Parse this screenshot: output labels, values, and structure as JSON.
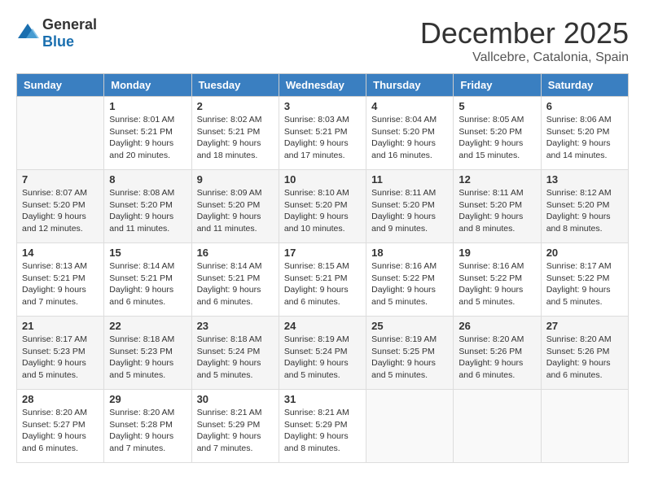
{
  "logo": {
    "general": "General",
    "blue": "Blue"
  },
  "title": {
    "month": "December 2025",
    "location": "Vallcebre, Catalonia, Spain"
  },
  "headers": [
    "Sunday",
    "Monday",
    "Tuesday",
    "Wednesday",
    "Thursday",
    "Friday",
    "Saturday"
  ],
  "weeks": [
    [
      {
        "day": "",
        "sunrise": "",
        "sunset": "",
        "daylight": ""
      },
      {
        "day": "1",
        "sunrise": "Sunrise: 8:01 AM",
        "sunset": "Sunset: 5:21 PM",
        "daylight": "Daylight: 9 hours and 20 minutes."
      },
      {
        "day": "2",
        "sunrise": "Sunrise: 8:02 AM",
        "sunset": "Sunset: 5:21 PM",
        "daylight": "Daylight: 9 hours and 18 minutes."
      },
      {
        "day": "3",
        "sunrise": "Sunrise: 8:03 AM",
        "sunset": "Sunset: 5:21 PM",
        "daylight": "Daylight: 9 hours and 17 minutes."
      },
      {
        "day": "4",
        "sunrise": "Sunrise: 8:04 AM",
        "sunset": "Sunset: 5:20 PM",
        "daylight": "Daylight: 9 hours and 16 minutes."
      },
      {
        "day": "5",
        "sunrise": "Sunrise: 8:05 AM",
        "sunset": "Sunset: 5:20 PM",
        "daylight": "Daylight: 9 hours and 15 minutes."
      },
      {
        "day": "6",
        "sunrise": "Sunrise: 8:06 AM",
        "sunset": "Sunset: 5:20 PM",
        "daylight": "Daylight: 9 hours and 14 minutes."
      }
    ],
    [
      {
        "day": "7",
        "sunrise": "Sunrise: 8:07 AM",
        "sunset": "Sunset: 5:20 PM",
        "daylight": "Daylight: 9 hours and 12 minutes."
      },
      {
        "day": "8",
        "sunrise": "Sunrise: 8:08 AM",
        "sunset": "Sunset: 5:20 PM",
        "daylight": "Daylight: 9 hours and 11 minutes."
      },
      {
        "day": "9",
        "sunrise": "Sunrise: 8:09 AM",
        "sunset": "Sunset: 5:20 PM",
        "daylight": "Daylight: 9 hours and 11 minutes."
      },
      {
        "day": "10",
        "sunrise": "Sunrise: 8:10 AM",
        "sunset": "Sunset: 5:20 PM",
        "daylight": "Daylight: 9 hours and 10 minutes."
      },
      {
        "day": "11",
        "sunrise": "Sunrise: 8:11 AM",
        "sunset": "Sunset: 5:20 PM",
        "daylight": "Daylight: 9 hours and 9 minutes."
      },
      {
        "day": "12",
        "sunrise": "Sunrise: 8:11 AM",
        "sunset": "Sunset: 5:20 PM",
        "daylight": "Daylight: 9 hours and 8 minutes."
      },
      {
        "day": "13",
        "sunrise": "Sunrise: 8:12 AM",
        "sunset": "Sunset: 5:20 PM",
        "daylight": "Daylight: 9 hours and 8 minutes."
      }
    ],
    [
      {
        "day": "14",
        "sunrise": "Sunrise: 8:13 AM",
        "sunset": "Sunset: 5:21 PM",
        "daylight": "Daylight: 9 hours and 7 minutes."
      },
      {
        "day": "15",
        "sunrise": "Sunrise: 8:14 AM",
        "sunset": "Sunset: 5:21 PM",
        "daylight": "Daylight: 9 hours and 6 minutes."
      },
      {
        "day": "16",
        "sunrise": "Sunrise: 8:14 AM",
        "sunset": "Sunset: 5:21 PM",
        "daylight": "Daylight: 9 hours and 6 minutes."
      },
      {
        "day": "17",
        "sunrise": "Sunrise: 8:15 AM",
        "sunset": "Sunset: 5:21 PM",
        "daylight": "Daylight: 9 hours and 6 minutes."
      },
      {
        "day": "18",
        "sunrise": "Sunrise: 8:16 AM",
        "sunset": "Sunset: 5:22 PM",
        "daylight": "Daylight: 9 hours and 5 minutes."
      },
      {
        "day": "19",
        "sunrise": "Sunrise: 8:16 AM",
        "sunset": "Sunset: 5:22 PM",
        "daylight": "Daylight: 9 hours and 5 minutes."
      },
      {
        "day": "20",
        "sunrise": "Sunrise: 8:17 AM",
        "sunset": "Sunset: 5:22 PM",
        "daylight": "Daylight: 9 hours and 5 minutes."
      }
    ],
    [
      {
        "day": "21",
        "sunrise": "Sunrise: 8:17 AM",
        "sunset": "Sunset: 5:23 PM",
        "daylight": "Daylight: 9 hours and 5 minutes."
      },
      {
        "day": "22",
        "sunrise": "Sunrise: 8:18 AM",
        "sunset": "Sunset: 5:23 PM",
        "daylight": "Daylight: 9 hours and 5 minutes."
      },
      {
        "day": "23",
        "sunrise": "Sunrise: 8:18 AM",
        "sunset": "Sunset: 5:24 PM",
        "daylight": "Daylight: 9 hours and 5 minutes."
      },
      {
        "day": "24",
        "sunrise": "Sunrise: 8:19 AM",
        "sunset": "Sunset: 5:24 PM",
        "daylight": "Daylight: 9 hours and 5 minutes."
      },
      {
        "day": "25",
        "sunrise": "Sunrise: 8:19 AM",
        "sunset": "Sunset: 5:25 PM",
        "daylight": "Daylight: 9 hours and 5 minutes."
      },
      {
        "day": "26",
        "sunrise": "Sunrise: 8:20 AM",
        "sunset": "Sunset: 5:26 PM",
        "daylight": "Daylight: 9 hours and 6 minutes."
      },
      {
        "day": "27",
        "sunrise": "Sunrise: 8:20 AM",
        "sunset": "Sunset: 5:26 PM",
        "daylight": "Daylight: 9 hours and 6 minutes."
      }
    ],
    [
      {
        "day": "28",
        "sunrise": "Sunrise: 8:20 AM",
        "sunset": "Sunset: 5:27 PM",
        "daylight": "Daylight: 9 hours and 6 minutes."
      },
      {
        "day": "29",
        "sunrise": "Sunrise: 8:20 AM",
        "sunset": "Sunset: 5:28 PM",
        "daylight": "Daylight: 9 hours and 7 minutes."
      },
      {
        "day": "30",
        "sunrise": "Sunrise: 8:21 AM",
        "sunset": "Sunset: 5:29 PM",
        "daylight": "Daylight: 9 hours and 7 minutes."
      },
      {
        "day": "31",
        "sunrise": "Sunrise: 8:21 AM",
        "sunset": "Sunset: 5:29 PM",
        "daylight": "Daylight: 9 hours and 8 minutes."
      },
      {
        "day": "",
        "sunrise": "",
        "sunset": "",
        "daylight": ""
      },
      {
        "day": "",
        "sunrise": "",
        "sunset": "",
        "daylight": ""
      },
      {
        "day": "",
        "sunrise": "",
        "sunset": "",
        "daylight": ""
      }
    ]
  ]
}
